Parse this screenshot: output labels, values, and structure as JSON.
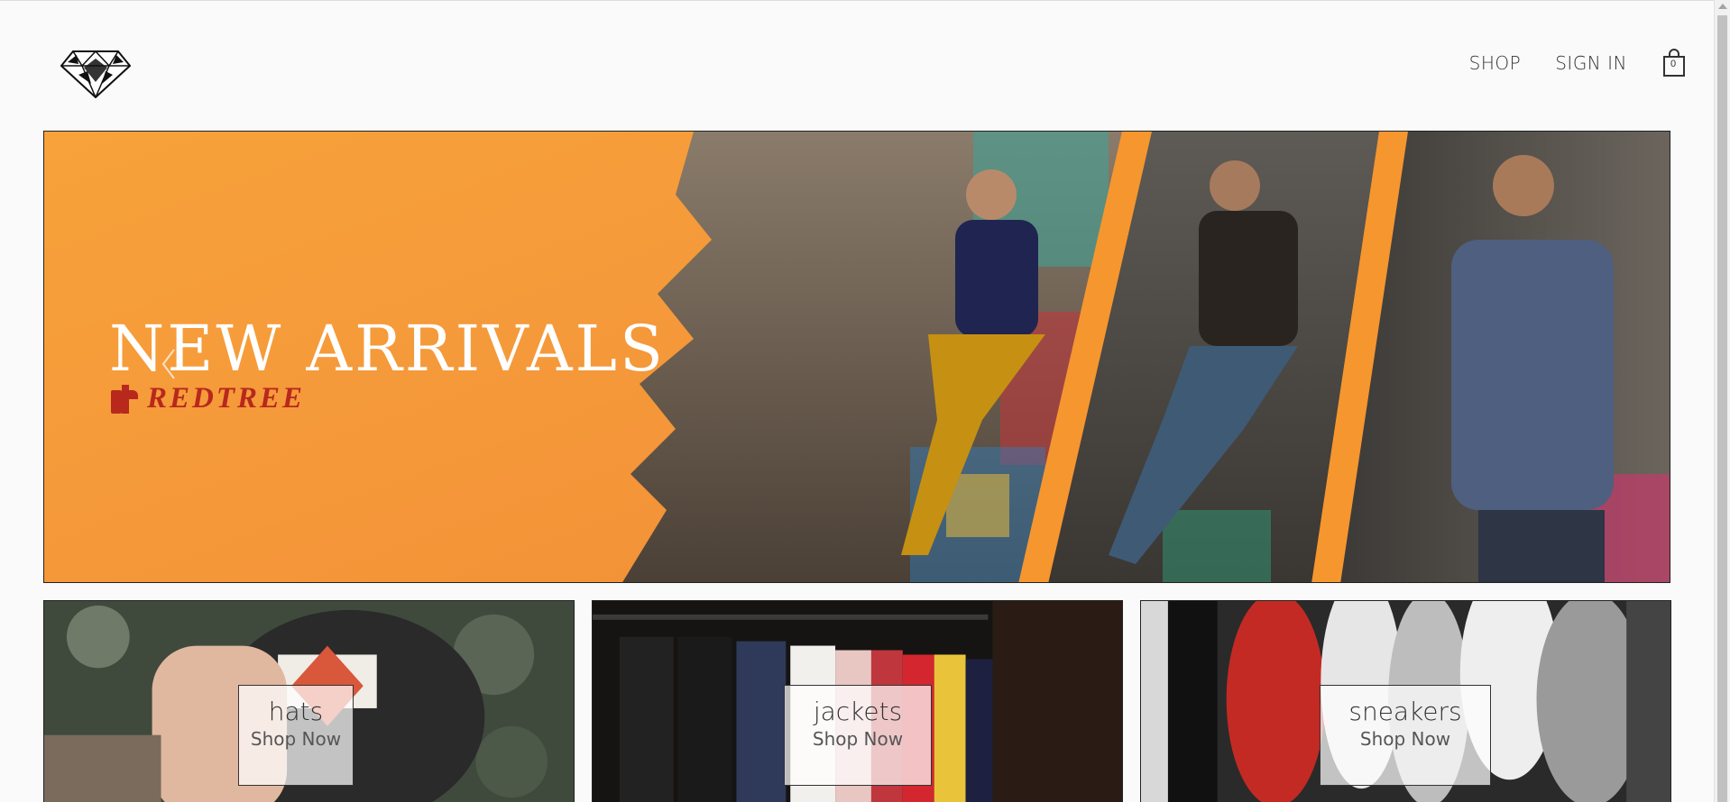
{
  "header": {
    "logo_icon": "diamond-icon",
    "nav": [
      {
        "label": "SHOP"
      },
      {
        "label": "SIGN IN"
      }
    ],
    "cart_icon": "shopping-bag-icon",
    "cart_count": "0"
  },
  "hero": {
    "title": "NEW ARRIVALS",
    "brand": "REDTREE",
    "brand_color": "#b8281d",
    "background_color": "#f59a3a",
    "prev_icon": "chevron-left-icon"
  },
  "categories": [
    {
      "title": "hats",
      "cta": "Shop Now"
    },
    {
      "title": "jackets",
      "cta": "Shop Now"
    },
    {
      "title": "sneakers",
      "cta": "Shop Now"
    }
  ]
}
